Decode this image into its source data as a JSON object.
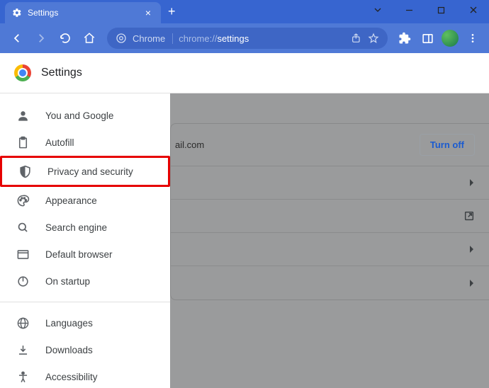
{
  "tab": {
    "title": "Settings"
  },
  "addressbar": {
    "prefix": "Chrome",
    "url_path": "settings",
    "url_scheme": "chrome://"
  },
  "page": {
    "title": "Settings"
  },
  "sidebar": {
    "items": [
      {
        "label": "You and Google"
      },
      {
        "label": "Autofill"
      },
      {
        "label": "Privacy and security"
      },
      {
        "label": "Appearance"
      },
      {
        "label": "Search engine"
      },
      {
        "label": "Default browser"
      },
      {
        "label": "On startup"
      }
    ],
    "secondary": [
      {
        "label": "Languages"
      },
      {
        "label": "Downloads"
      },
      {
        "label": "Accessibility"
      }
    ]
  },
  "main": {
    "email_fragment": "ail.com",
    "turn_off": "Turn off"
  }
}
